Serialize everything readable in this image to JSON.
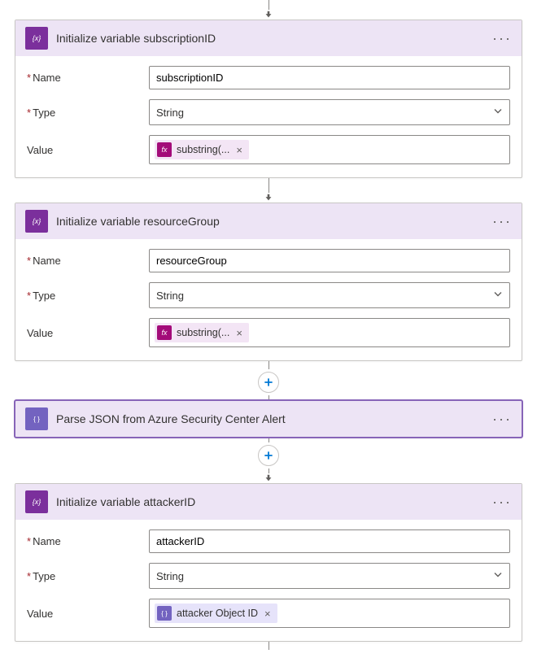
{
  "steps": [
    {
      "id": "step1",
      "title": "Initialize variable subscriptionID",
      "icon": "variable",
      "expanded": true,
      "fields": {
        "name": {
          "label": "Name",
          "required": true,
          "value": "subscriptionID"
        },
        "type": {
          "label": "Type",
          "required": true,
          "value": "String"
        },
        "value": {
          "label": "Value",
          "required": false,
          "chip": {
            "kind": "fx",
            "text": "substring(..."
          }
        }
      }
    },
    {
      "id": "step2",
      "title": "Initialize variable resourceGroup",
      "icon": "variable",
      "expanded": true,
      "fields": {
        "name": {
          "label": "Name",
          "required": true,
          "value": "resourceGroup"
        },
        "type": {
          "label": "Type",
          "required": true,
          "value": "String"
        },
        "value": {
          "label": "Value",
          "required": false,
          "chip": {
            "kind": "fx",
            "text": "substring(..."
          }
        }
      }
    },
    {
      "id": "step3",
      "title": "Parse JSON from Azure Security Center Alert",
      "icon": "json",
      "expanded": false,
      "selected": true
    },
    {
      "id": "step4",
      "title": "Initialize variable attackerID",
      "icon": "variable",
      "expanded": true,
      "fields": {
        "name": {
          "label": "Name",
          "required": true,
          "value": "attackerID"
        },
        "type": {
          "label": "Type",
          "required": true,
          "value": "String"
        },
        "value": {
          "label": "Value",
          "required": false,
          "chip": {
            "kind": "json",
            "text": "attacker Object ID"
          }
        }
      }
    }
  ],
  "ui": {
    "required_marker": "*",
    "menu_dots": "···",
    "chip_close": "×"
  }
}
